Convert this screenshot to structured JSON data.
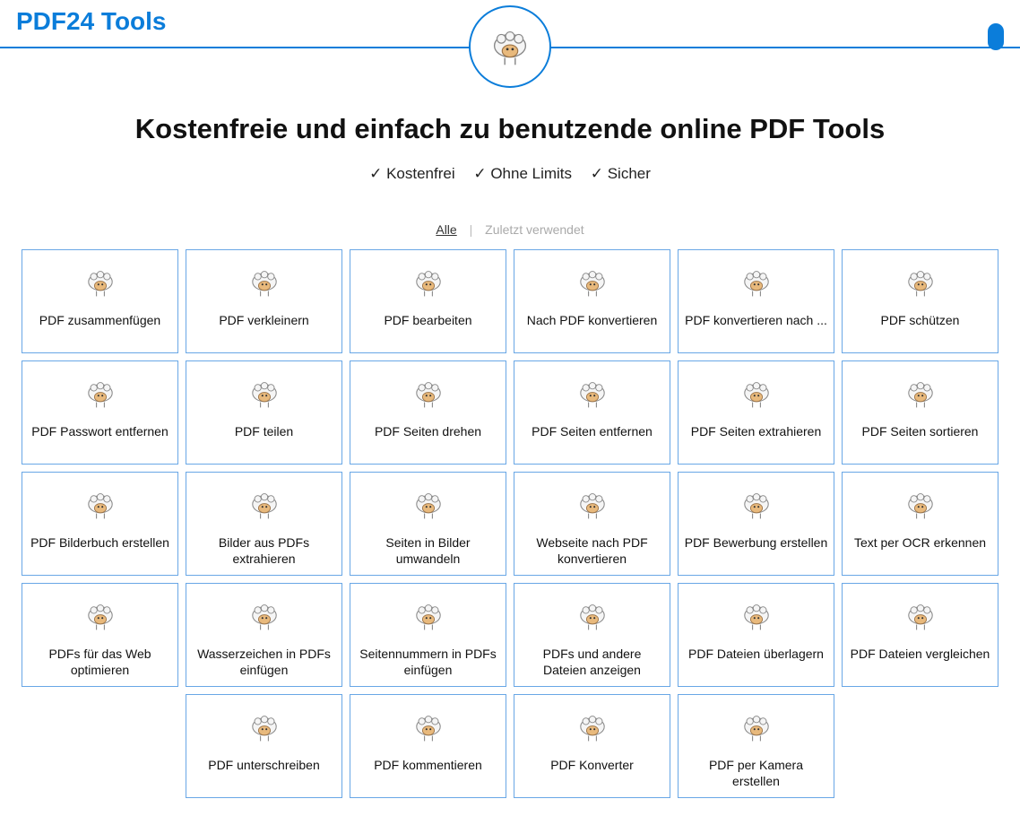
{
  "brand": "PDF24 Tools",
  "hero": {
    "headline": "Kostenfreie und einfach zu benutzende online PDF Tools",
    "features": [
      "Kostenfrei",
      "Ohne Limits",
      "Sicher"
    ]
  },
  "filter": {
    "all": "Alle",
    "recent": "Zuletzt verwendet"
  },
  "tools": [
    {
      "label": "PDF zusammenfügen"
    },
    {
      "label": "PDF verkleinern"
    },
    {
      "label": "PDF bearbeiten"
    },
    {
      "label": "Nach PDF konvertieren"
    },
    {
      "label": "PDF konvertieren nach ..."
    },
    {
      "label": "PDF schützen"
    },
    {
      "label": "PDF Passwort entfernen"
    },
    {
      "label": "PDF teilen"
    },
    {
      "label": "PDF Seiten drehen"
    },
    {
      "label": "PDF Seiten entfernen"
    },
    {
      "label": "PDF Seiten extrahieren"
    },
    {
      "label": "PDF Seiten sortieren"
    },
    {
      "label": "PDF Bilderbuch erstellen"
    },
    {
      "label": "Bilder aus PDFs extrahieren"
    },
    {
      "label": "Seiten in Bilder umwandeln"
    },
    {
      "label": "Webseite nach PDF konvertieren"
    },
    {
      "label": "PDF Bewerbung erstellen"
    },
    {
      "label": "Text per OCR erkennen"
    },
    {
      "label": "PDFs für das Web optimieren"
    },
    {
      "label": "Wasserzeichen in PDFs einfügen"
    },
    {
      "label": "Seitennummern in PDFs einfügen"
    },
    {
      "label": "PDFs und andere Dateien anzeigen"
    },
    {
      "label": "PDF Dateien überlagern"
    },
    {
      "label": "PDF Dateien vergleichen"
    },
    {
      "label": "PDF unterschreiben"
    },
    {
      "label": "PDF kommentieren"
    },
    {
      "label": "PDF Konverter"
    },
    {
      "label": "PDF per Kamera erstellen"
    }
  ]
}
